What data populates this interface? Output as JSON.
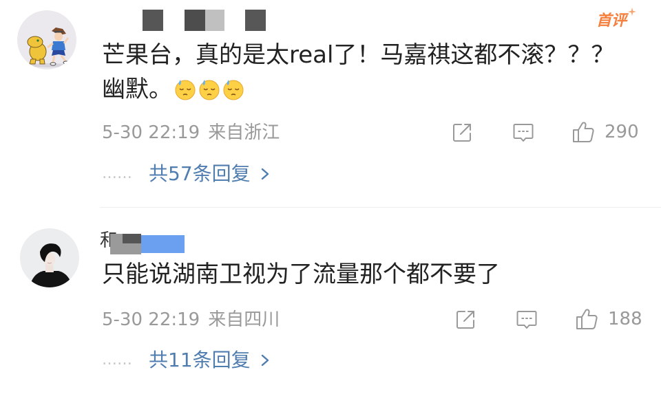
{
  "colors": {
    "text_primary": "#222222",
    "text_meta": "#999999",
    "link_blue": "#507daf",
    "badge_orange": "#f5803e",
    "divider": "#ededed"
  },
  "icons": {
    "share": "share-icon",
    "comment": "comment-icon",
    "like": "thumbs-up-icon",
    "more_replies": "chevron-right-icon",
    "emoji": "sweat-face-emoji-icon"
  },
  "comments": [
    {
      "avatar_icon": "cartoon-avatar-icon",
      "badge": "首评",
      "text_lines": [
        "芒果台，真的是太real了！马嘉祺这都不滚？？？",
        "幽默。"
      ],
      "emojis": [
        "sweat-face-emoji-icon",
        "sweat-face-emoji-icon",
        "sweat-face-emoji-icon"
      ],
      "time": "5-30 22:19",
      "location": "来自浙江",
      "likes": "290",
      "reply_prefix": "……",
      "replies_label": "共57条回复"
    },
    {
      "avatar_icon": "photo-avatar-icon",
      "username_visible": "和",
      "text_lines": [
        "只能说湖南卫视为了流量那个都不要了"
      ],
      "time": "5-30 22:19",
      "location": "来自四川",
      "likes": "188",
      "reply_prefix": "……",
      "replies_label": "共11条回复"
    }
  ]
}
